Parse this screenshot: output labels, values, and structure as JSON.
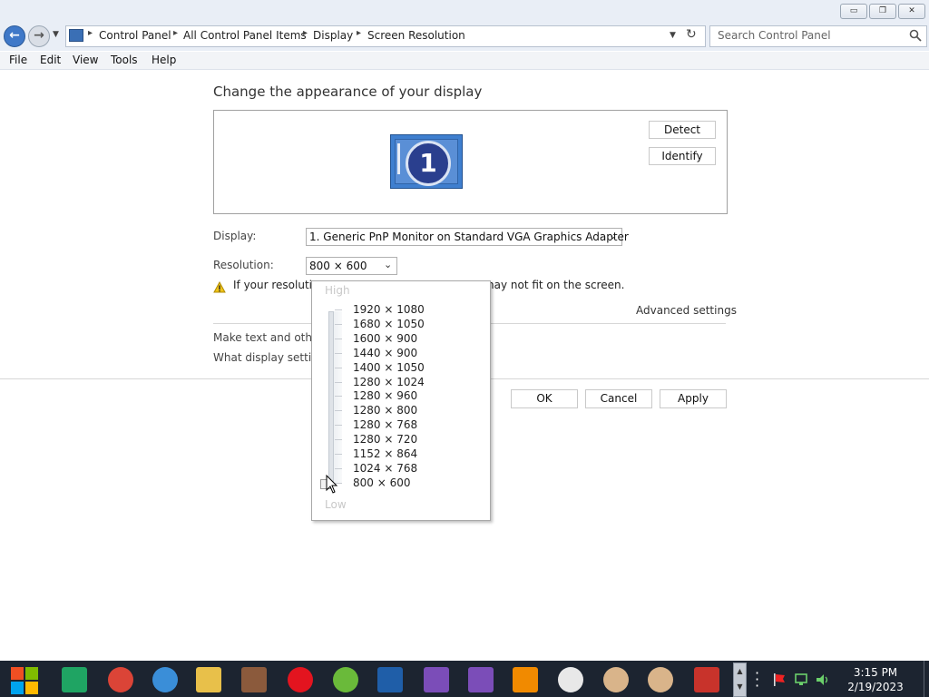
{
  "window": {
    "controls": {
      "minimize": "▭",
      "restore": "❐",
      "close": "✕"
    }
  },
  "address": {
    "crumbs": [
      "Control Panel",
      "All Control Panel Items",
      "Display",
      "Screen Resolution"
    ],
    "search_placeholder": "Search Control Panel"
  },
  "menu": [
    "File",
    "Edit",
    "View",
    "Tools",
    "Help"
  ],
  "content": {
    "heading": "Change the appearance of your display",
    "monitor_number": "1",
    "detect_label": "Detect",
    "identify_label": "Identify",
    "display_label": "Display:",
    "display_value": "1. Generic PnP Monitor on Standard VGA Graphics Adapter",
    "resolution_label": "Resolution:",
    "resolution_value": "800 × 600",
    "warning_left": "If your resolutio",
    "warning_right": "nay not fit on the screen.",
    "advanced_link": "Advanced settings",
    "link1": "Make text and othe",
    "link2": "What display settin",
    "ok_label": "OK",
    "cancel_label": "Cancel",
    "apply_label": "Apply"
  },
  "dropdown": {
    "high_label": "High",
    "low_label": "Low",
    "resolutions": [
      "1920 × 1080",
      "1680 × 1050",
      "1600 × 900",
      "1440 × 900",
      "1400 × 1050",
      "1280 × 1024",
      "1280 × 960",
      "1280 × 800",
      "1280 × 768",
      "1280 × 720",
      "1152 × 864",
      "1024 × 768",
      "800 × 600"
    ],
    "selected": "800 × 600"
  },
  "taskbar": {
    "apps": [
      "start-icon",
      "spreadsheets-icon",
      "chrome-icon",
      "network-globe-icon",
      "file-explorer-icon",
      "portrait-icon",
      "opera-icon",
      "utorrent-icon",
      "virtualbox-icon",
      "cpuz-icon",
      "cpuz-icon",
      "vlc-icon",
      "skull-icon",
      "user-doctor-icon",
      "user-doctor-icon",
      "ccleaner-icon"
    ],
    "time": "3:15 PM",
    "date": "2/19/2023"
  },
  "colors": {
    "accent": "#3f78c8",
    "taskbar": "#1c2430",
    "warning": "#f0c419"
  }
}
